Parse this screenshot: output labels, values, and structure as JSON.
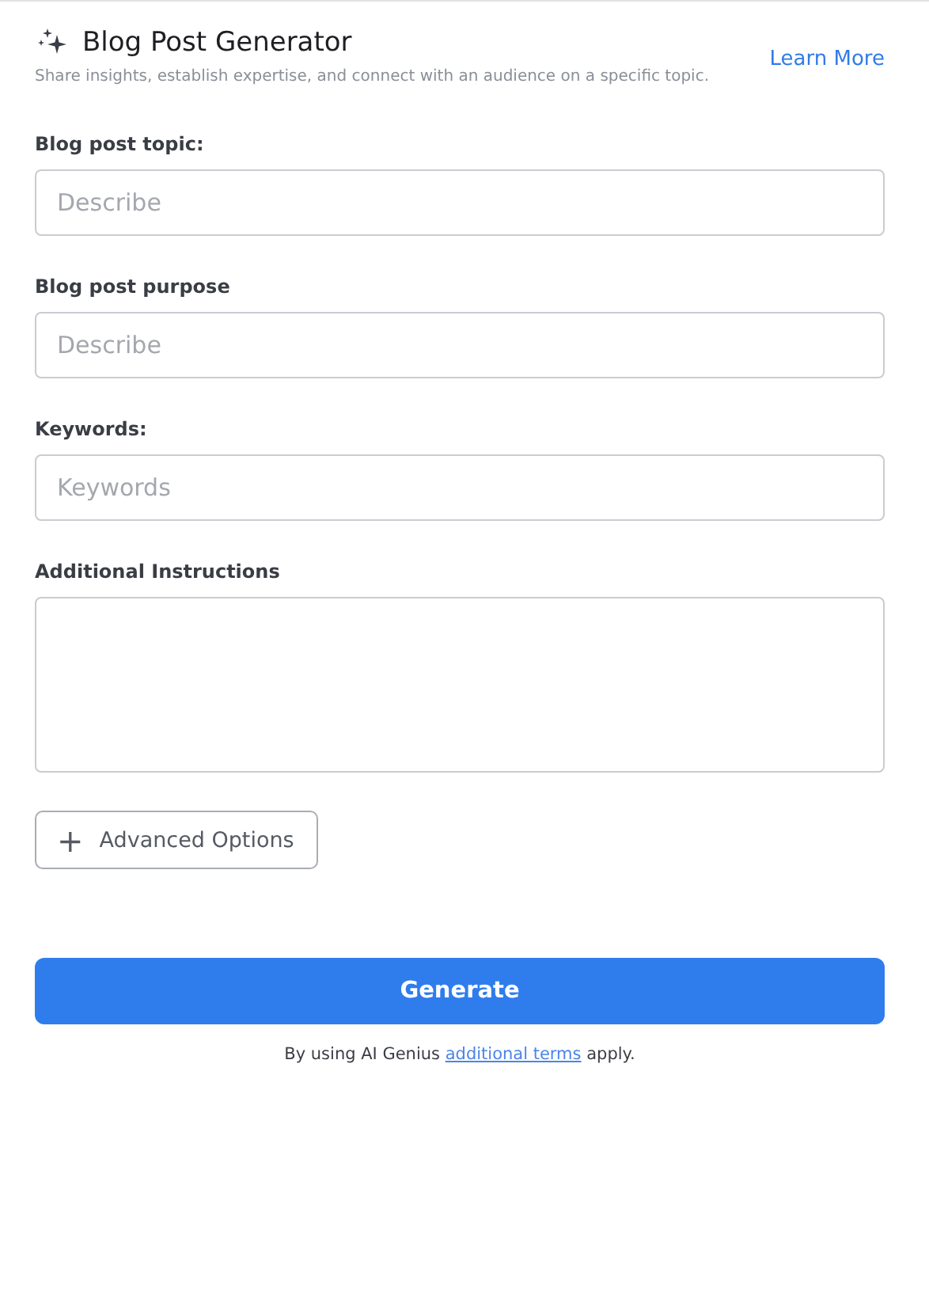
{
  "header": {
    "title": "Blog Post Generator",
    "subtitle": "Share insights, establish expertise, and connect with an audience on a specific topic.",
    "link": "Learn More"
  },
  "fields": [
    {
      "kind": "input",
      "label": "Blog post topic:",
      "placeholder": "Describe"
    },
    {
      "kind": "input",
      "label": "Blog post purpose",
      "placeholder": "Describe"
    },
    {
      "kind": "input",
      "label": "Keywords:",
      "placeholder": "Keywords"
    },
    {
      "kind": "textarea",
      "label": "Additional Instructions"
    }
  ],
  "advanced_button": {
    "icon": "+",
    "label": "Advanced Options"
  },
  "generate_button": "Generate",
  "footer": {
    "before": "By using AI Genius",
    "link": "additional terms",
    "after": "apply."
  }
}
